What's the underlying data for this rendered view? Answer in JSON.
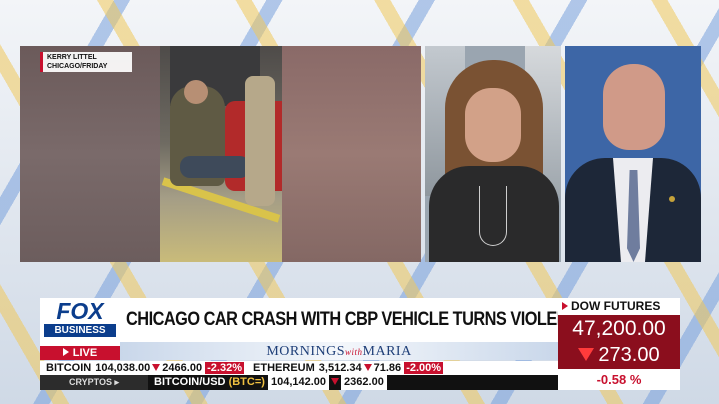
{
  "video": {
    "source_label_line1": "KERRY LITTEL",
    "source_label_line2": "CHICAGO/FRIDAY"
  },
  "brand": {
    "logo_top": "FOX",
    "logo_bottom": "BUSINESS",
    "live_label": "LIVE",
    "show_name_part1": "MORNINGS",
    "show_name_with": "with",
    "show_name_part2": "MARIA"
  },
  "headline": "CHICAGO CAR CRASH WITH CBP VEHICLE TURNS VIOLENT",
  "ticker_top": [
    {
      "name": "BITCOIN",
      "value": "104,038.00",
      "change": "2466.00",
      "pct": "-2.32%"
    },
    {
      "name": "ETHEREUM",
      "value": "3,512.34",
      "change": "71.86",
      "pct": "-2.00%"
    }
  ],
  "ticker_bottom": {
    "tag": "CRYPTOS",
    "pair": "BITCOIN/USD",
    "symbol": "(BTC=)",
    "value": "104,142.00",
    "change": "2362.00"
  },
  "dow": {
    "title": "DOW FUTURES",
    "value": "47,200.00",
    "change": "273.00",
    "pct": "-0.58 %"
  },
  "colors": {
    "fox_red": "#c8102e",
    "fox_blue": "#0b3d8c",
    "dow_bg": "#8b0e1d"
  }
}
